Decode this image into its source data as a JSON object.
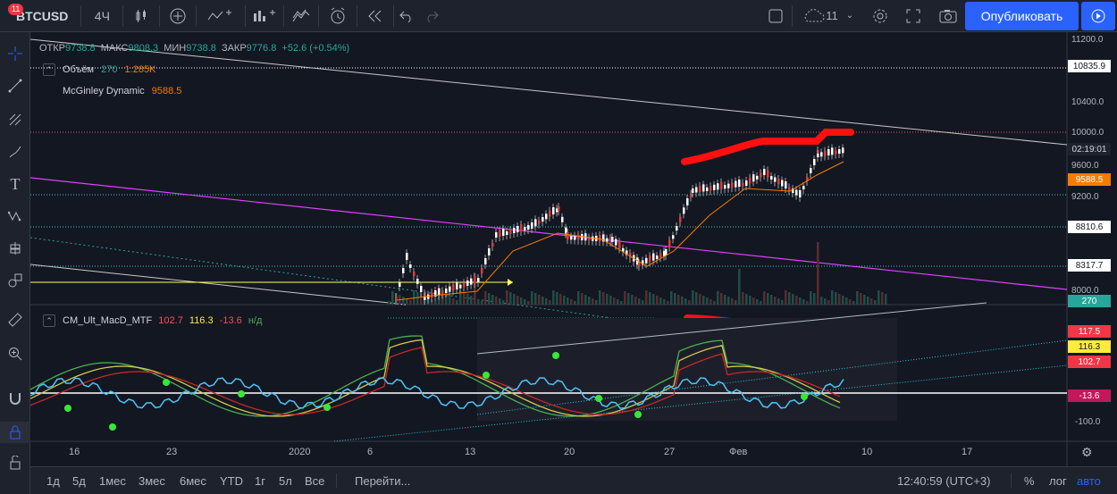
{
  "toolbar": {
    "symbol": "BTCUSD",
    "interval": "4Ч",
    "cloud_count": "11",
    "publish_label": "Опубликовать",
    "badge_count": "11"
  },
  "legend": {
    "ohlc": {
      "open_label": "ОТКР",
      "open": "9738.8",
      "high_label": "МАКС",
      "high": "9808.3",
      "low_label": "МИН",
      "low": "9738.8",
      "close_label": "ЗАКР",
      "close": "9776.8",
      "change": "+52.6 (+0.54%)"
    },
    "volume": {
      "name": "Объём",
      "v1": "270",
      "v2": "1.285K"
    },
    "mcginley": {
      "name": "McGinley Dynamic",
      "value": "9588.5"
    },
    "macd": {
      "name": "CM_Ult_MacD_MTF",
      "v1": "102.7",
      "v2": "116.3",
      "v3": "-13.6",
      "v4": "н/д"
    }
  },
  "price_axis": {
    "labels": [
      "11200.0",
      "10400.0",
      "10000.0",
      "9600.0",
      "9200.0",
      "8800.0",
      "8000.0"
    ],
    "tags": {
      "t1": "10835.9",
      "t2": "02:19:01",
      "t3": "9588.5",
      "t4": "8810.6",
      "t5": "8317.7",
      "t6": "270"
    }
  },
  "macd_axis": {
    "labels": [
      "-100.0"
    ],
    "tags": {
      "a": "117.5",
      "b": "116.3",
      "c": "102.7",
      "d": "-13.6"
    }
  },
  "time_axis": [
    "16",
    "23",
    "2020",
    "6",
    "13",
    "20",
    "27",
    "Фев",
    "10",
    "17"
  ],
  "bottombar": {
    "ranges": [
      "1д",
      "5д",
      "1мес",
      "3мес",
      "6мес",
      "YTD",
      "1г",
      "5л",
      "Все"
    ],
    "goto": "Перейти...",
    "clock": "12:40:59 (UTC+3)",
    "percent": "%",
    "log": "лог",
    "auto": "авто"
  },
  "colors": {
    "bg": "#131722",
    "up": "#26a69a",
    "down": "#ef5350",
    "accent": "#2962ff",
    "magenta": "#e040fb",
    "mcginley": "#f57c00",
    "drawing_red": "#ff1010"
  }
}
